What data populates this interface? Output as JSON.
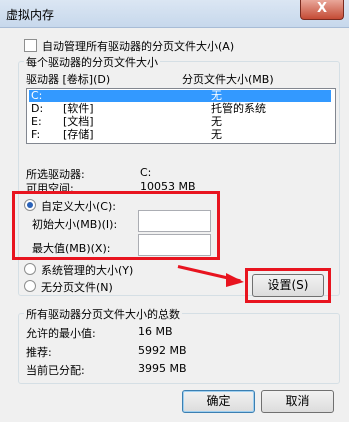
{
  "window": {
    "title": "虚拟内存",
    "close_glyph": "X"
  },
  "auto_manage": {
    "label": "自动管理所有驱动器的分页文件大小(A)",
    "checked": false
  },
  "per_drive_group": {
    "legend": "每个驱动器的分页文件大小"
  },
  "drive_list": {
    "header_drive": "驱动器 [卷标](D)",
    "header_size": "分页文件大小(MB)",
    "rows": [
      {
        "drive": "C:",
        "label": "",
        "size": "无",
        "selected": true
      },
      {
        "drive": "D:",
        "label": "[软件]",
        "size": "托管的系统",
        "selected": false
      },
      {
        "drive": "E:",
        "label": "[文档]",
        "size": "无",
        "selected": false
      },
      {
        "drive": "F:",
        "label": "[存储]",
        "size": "无",
        "selected": false
      }
    ]
  },
  "selected_info": {
    "drive_label": "所选驱动器:",
    "drive_value": "C:",
    "space_label": "可用空间:",
    "space_value": "10053 MB"
  },
  "custom_size": {
    "label": "自定义大小(C):",
    "initial_label": "初始大小(MB)(I):",
    "initial_value": "",
    "max_label": "最大值(MB)(X):",
    "max_value": ""
  },
  "system_managed": {
    "label": "系统管理的大小(Y)"
  },
  "no_paging": {
    "label": "无分页文件(N)"
  },
  "set_button": {
    "label": "设置(S)"
  },
  "total_group": {
    "legend": "所有驱动器分页文件大小的总数",
    "min_label": "允许的最小值:",
    "min_value": "16 MB",
    "recommended_label": "推荐:",
    "recommended_value": "5992 MB",
    "allocated_label": "当前已分配:",
    "allocated_value": "3995 MB"
  },
  "footer": {
    "ok_label": "确定",
    "cancel_label": "取消"
  },
  "colors": {
    "highlight": "#e8141f",
    "selection": "#3399ff",
    "radio_dot": "#2a62b8"
  }
}
